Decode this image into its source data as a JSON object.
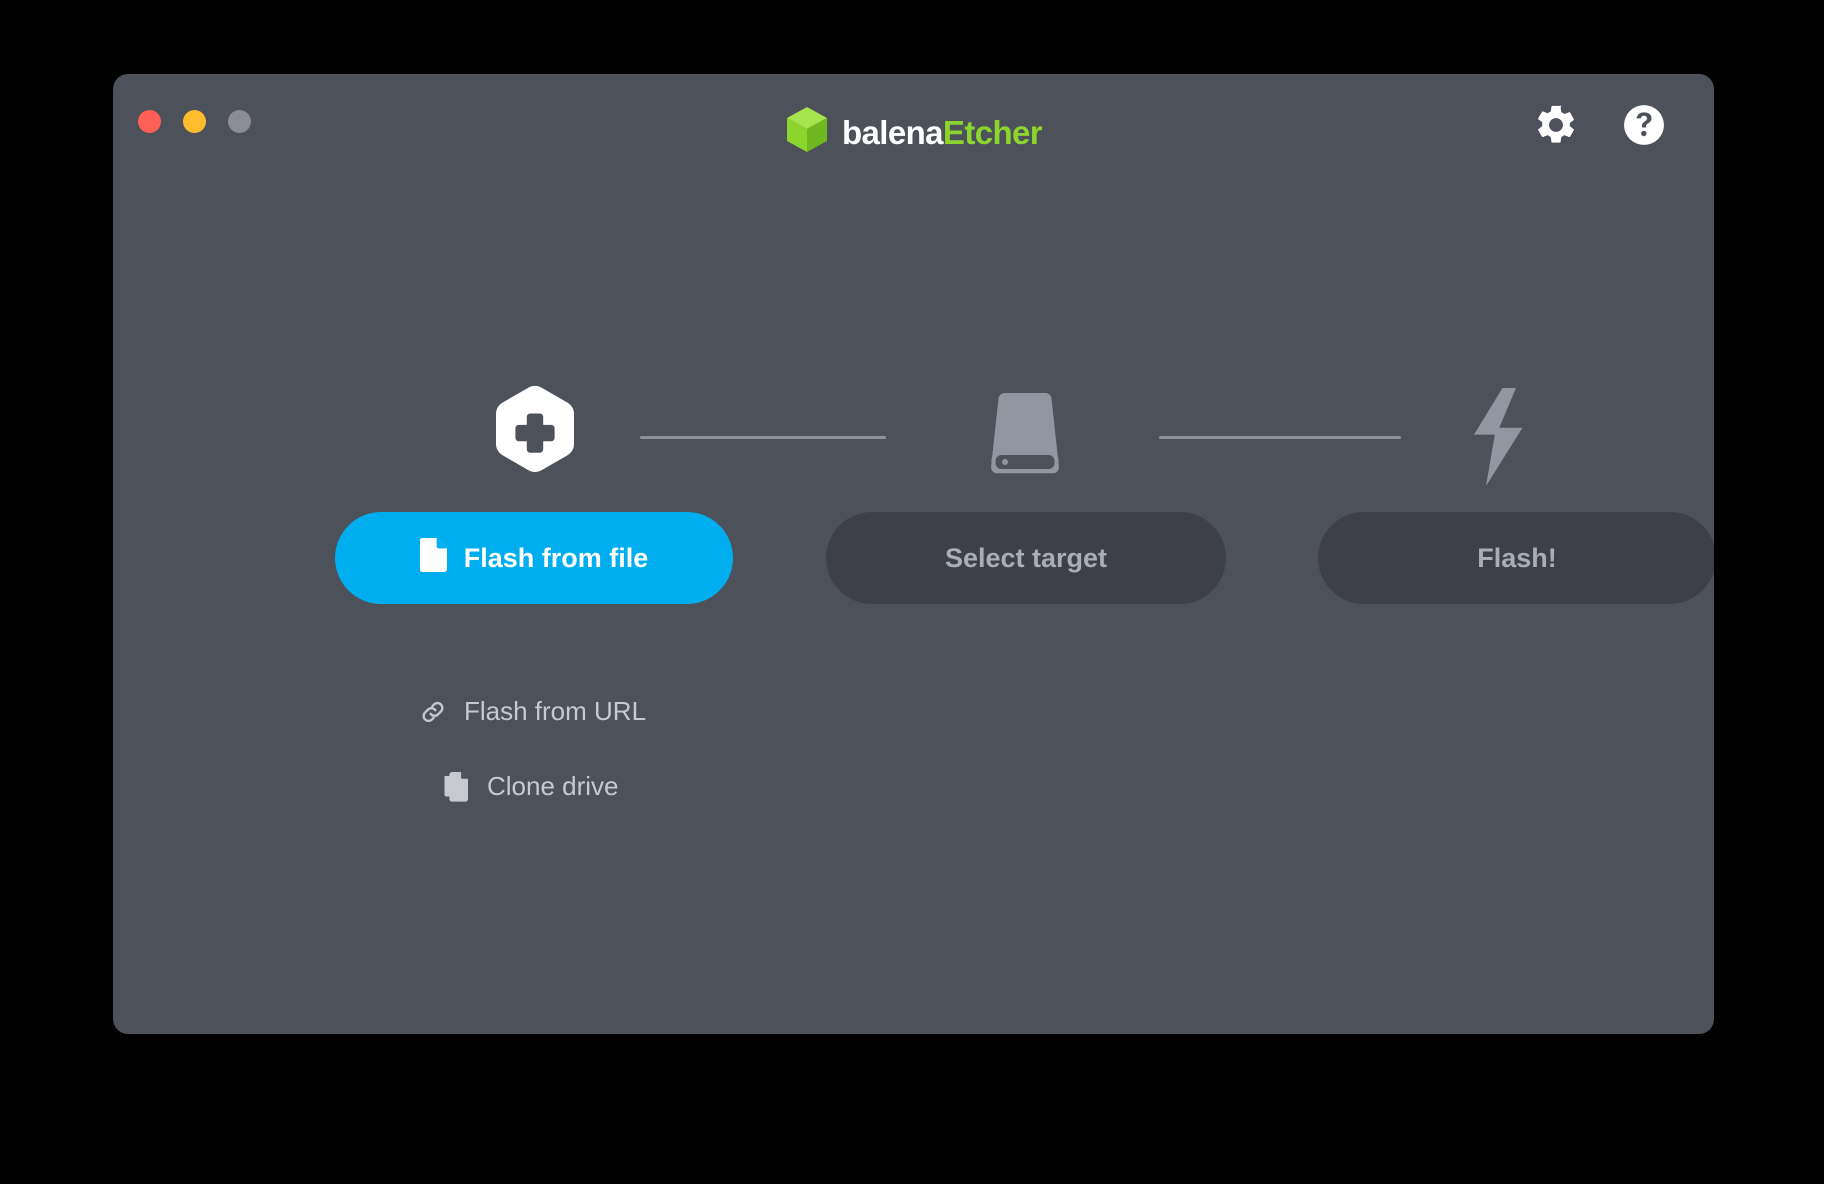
{
  "window": {
    "background_color": "#4D515A",
    "desktop_background_color": "#000000"
  },
  "titlebar": {
    "traffic_lights": [
      {
        "name": "close",
        "color": "#FF5F56"
      },
      {
        "name": "minimize",
        "color": "#FFBD2E"
      },
      {
        "name": "zoom",
        "color": "#8A8D93"
      }
    ],
    "brand": {
      "primary": "balena",
      "accent": "Etcher",
      "primary_color": "#FFFFFF",
      "accent_color": "#8CD52D",
      "logo_icon": "green-cube-icon"
    },
    "actions": [
      {
        "name": "settings",
        "icon": "gear-icon",
        "color": "#FFFFFF"
      },
      {
        "name": "help",
        "icon": "question-circle-icon",
        "color": "#FFFFFF"
      }
    ]
  },
  "steps": [
    {
      "id": "image",
      "icon": "hexagon-plus-icon",
      "state": "active",
      "icon_color": "#FFFFFF"
    },
    {
      "id": "drive",
      "icon": "drive-icon",
      "state": "disabled",
      "icon_color": "#9296A0"
    },
    {
      "id": "flash",
      "icon": "lightning-bolt-icon",
      "state": "disabled",
      "icon_color": "#9296A0"
    }
  ],
  "connector_color": "#8E939B",
  "actions": {
    "flash_from_file": {
      "label": "Flash from file",
      "icon": "document-icon",
      "state": "enabled",
      "background_color": "#00AEEF",
      "text_color": "#FFFFFF"
    },
    "select_target": {
      "label": "Select target",
      "state": "disabled",
      "background_color": "#3D4048",
      "text_color": "#A9ADB4"
    },
    "flash": {
      "label": "Flash!",
      "state": "disabled",
      "background_color": "#3D4048",
      "text_color": "#A9ADB4"
    }
  },
  "links": [
    {
      "label": "Flash from URL",
      "icon": "link-chain-icon",
      "text_color": "#C6CAD0"
    },
    {
      "label": "Clone drive",
      "icon": "copy-icon",
      "text_color": "#C6CAD0"
    }
  ]
}
